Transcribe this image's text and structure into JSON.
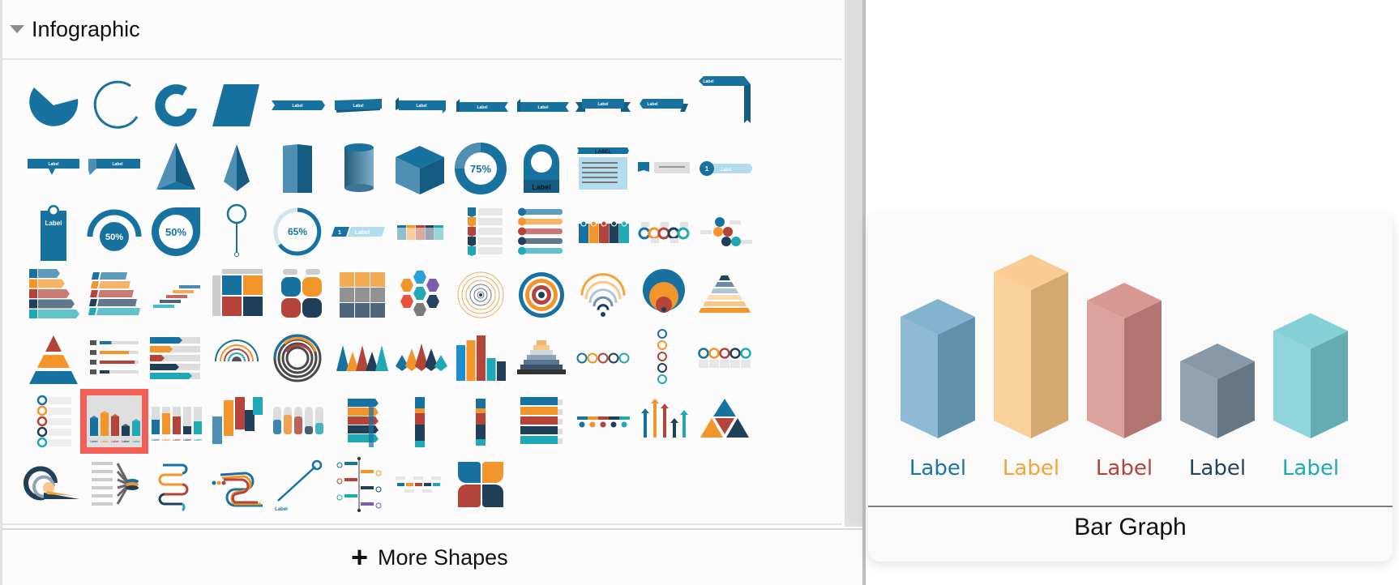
{
  "section": {
    "title": "Infographic",
    "expanded": true
  },
  "shapes": [
    {
      "name": "pie-partial",
      "row": 0
    },
    {
      "name": "open-arc",
      "row": 0
    },
    {
      "name": "thick-arc",
      "row": 0
    },
    {
      "name": "parallelogram",
      "row": 0
    },
    {
      "name": "ribbon-arrow",
      "row": 0,
      "text": "Label"
    },
    {
      "name": "ribbon-tilted",
      "row": 0,
      "text": "Label"
    },
    {
      "name": "ribbon-folded-left",
      "row": 0,
      "text": "Label"
    },
    {
      "name": "ribbon-notched",
      "row": 0,
      "text": "Label"
    },
    {
      "name": "ribbon-notched-2",
      "row": 0,
      "text": "Label"
    },
    {
      "name": "ribbon-banner",
      "row": 0,
      "text": "Label"
    },
    {
      "name": "ribbon-flag",
      "row": 0,
      "text": "Label"
    },
    {
      "name": "ribbon-corner",
      "row": 0,
      "text": "Label"
    },
    {
      "name": "callout-bottom",
      "row": 1,
      "text": "Label"
    },
    {
      "name": "callout-fold",
      "row": 1,
      "text": "Label"
    },
    {
      "name": "pyramid-3d",
      "row": 1
    },
    {
      "name": "pyramid-tall",
      "row": 1
    },
    {
      "name": "prism",
      "row": 1
    },
    {
      "name": "cylinder",
      "row": 1
    },
    {
      "name": "cube",
      "row": 1
    },
    {
      "name": "donut-75",
      "row": 1,
      "text": "75%"
    },
    {
      "name": "tag-label",
      "row": 1,
      "text": "Label"
    },
    {
      "name": "text-card",
      "row": 1,
      "text": "LABEL"
    },
    {
      "name": "note-card",
      "row": 1
    },
    {
      "name": "numbered-pill",
      "row": 1,
      "text": "1"
    },
    {
      "name": "hang-tag",
      "row": 2,
      "text": "Label"
    },
    {
      "name": "gauge-50",
      "row": 2,
      "text": "50%"
    },
    {
      "name": "drop-50",
      "row": 2,
      "text": "50%"
    },
    {
      "name": "pin",
      "row": 2
    },
    {
      "name": "progress-65",
      "row": 2,
      "text": "65%"
    },
    {
      "name": "numbered-tab",
      "row": 2,
      "text": "Label"
    },
    {
      "name": "table-grid",
      "row": 2
    },
    {
      "name": "step-list",
      "row": 2
    },
    {
      "name": "numbered-list",
      "row": 2
    },
    {
      "name": "column-cards",
      "row": 2
    },
    {
      "name": "wave-circles",
      "row": 2
    },
    {
      "name": "gear-cluster",
      "row": 2
    },
    {
      "name": "stair-list",
      "row": 3
    },
    {
      "name": "slanted-list",
      "row": 3
    },
    {
      "name": "stair-steps",
      "row": 3
    },
    {
      "name": "matrix-2x2",
      "row": 3
    },
    {
      "name": "matrix-rounded",
      "row": 3
    },
    {
      "name": "matrix-3x3",
      "row": 3
    },
    {
      "name": "hexagon-cluster",
      "row": 3
    },
    {
      "name": "ripple",
      "row": 3
    },
    {
      "name": "target",
      "row": 3
    },
    {
      "name": "signal-arcs",
      "row": 3
    },
    {
      "name": "nested-circles",
      "row": 3
    },
    {
      "name": "stacked-pyramid",
      "row": 3
    },
    {
      "name": "pyramid-3-level",
      "row": 4
    },
    {
      "name": "progress-bars",
      "row": 4
    },
    {
      "name": "arrow-bars",
      "row": 4
    },
    {
      "name": "arc-gauge",
      "row": 4
    },
    {
      "name": "radial-bars",
      "row": 4
    },
    {
      "name": "triangle-peaks",
      "row": 4
    },
    {
      "name": "cone-peaks",
      "row": 4
    },
    {
      "name": "arrow-columns",
      "row": 4
    },
    {
      "name": "step-pyramid",
      "row": 4
    },
    {
      "name": "ring-row",
      "row": 4
    },
    {
      "name": "ring-column",
      "row": 4
    },
    {
      "name": "ring-cards",
      "row": 4
    },
    {
      "name": "ring-list",
      "row": 5
    },
    {
      "name": "bar-graph-3d",
      "row": 5,
      "selected": true
    },
    {
      "name": "glass-bars",
      "row": 5
    },
    {
      "name": "skyline-3d",
      "row": 5
    },
    {
      "name": "glass-cylinders",
      "row": 5
    },
    {
      "name": "ribbon-stack",
      "row": 5
    },
    {
      "name": "cylinder-stack",
      "row": 5
    },
    {
      "name": "cylinder-stack-2",
      "row": 5
    },
    {
      "name": "banner-list",
      "row": 5
    },
    {
      "name": "timeline-dots",
      "row": 5
    },
    {
      "name": "arrows-up",
      "row": 5
    },
    {
      "name": "triangle-split",
      "row": 5
    },
    {
      "name": "spiral-ramp",
      "row": 6
    },
    {
      "name": "fan-out",
      "row": 6
    },
    {
      "name": "s-curve",
      "row": 6
    },
    {
      "name": "road-curve",
      "row": 6
    },
    {
      "name": "pin-line",
      "row": 6,
      "text": "Label"
    },
    {
      "name": "vertical-timeline",
      "row": 6
    },
    {
      "name": "mini-timeline",
      "row": 6
    },
    {
      "name": "four-leaf",
      "row": 6
    }
  ],
  "footer": {
    "more_shapes_icon": "plus-icon",
    "more_shapes_label": "More Shapes"
  },
  "preview": {
    "title": "Bar Graph",
    "bars": [
      {
        "label": "Label",
        "value": 0.6,
        "color": "#1b75a8"
      },
      {
        "label": "Label",
        "value": 0.82,
        "color": "#f5a33a"
      },
      {
        "label": "Label",
        "value": 0.68,
        "color": "#b6433a"
      },
      {
        "label": "Label",
        "value": 0.38,
        "color": "#24445f"
      },
      {
        "label": "Label",
        "value": 0.53,
        "color": "#1ea9b4"
      }
    ]
  },
  "colors": {
    "accent": "#17729f",
    "orange": "#f2952a",
    "red": "#b4433a",
    "navy": "#223f5a",
    "teal": "#1fa9b5",
    "selection": "#f35f55"
  }
}
